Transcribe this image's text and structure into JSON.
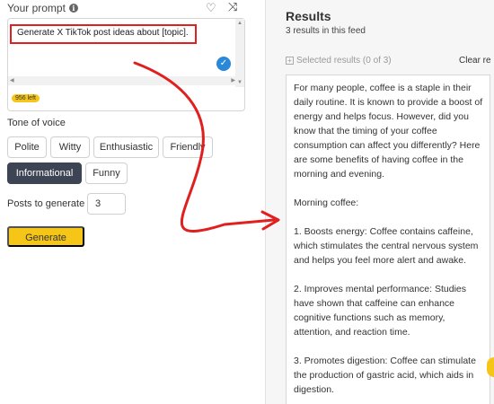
{
  "prompt": {
    "label": "Your prompt",
    "text": "Generate X TikTok post ideas about [topic].",
    "chars_left": "956 left"
  },
  "icons": {
    "info": "info-icon",
    "favorite": "heart-icon",
    "randomize": "shuffle-icon",
    "confirm": "check-icon"
  },
  "tone": {
    "label": "Tone of voice",
    "options": [
      "Polite",
      "Witty",
      "Enthusiastic",
      "Friendly",
      "Informational",
      "Funny"
    ],
    "selected": "Informational"
  },
  "posts": {
    "label": "Posts to generate",
    "value": "3"
  },
  "generate_label": "Generate",
  "results": {
    "title": "Results",
    "count": "3 results in this feed",
    "selected": "Selected results (0 of 3)",
    "clear": "Clear re",
    "body": "For many people, coffee is a staple in their daily routine. It is known to provide a boost of energy and helps focus. However, did you know that the timing of your coffee consumption can affect you differently? Here are some benefits of having coffee in the morning and evening.\n\nMorning coffee:\n\n1. Boosts energy: Coffee contains caffeine, which stimulates the central nervous system and helps you feel more alert and awake.\n\n2. Improves mental performance: Studies have shown that caffeine can enhance cognitive functions such as memory, attention, and reaction time.\n\n3. Promotes digestion: Coffee can stimulate the production of gastric acid, which aids in digestion."
  },
  "colors": {
    "accent": "#f5c518",
    "selected_tone": "#3d4453",
    "annotation": "#e0201f",
    "check": "#2a88d8"
  }
}
